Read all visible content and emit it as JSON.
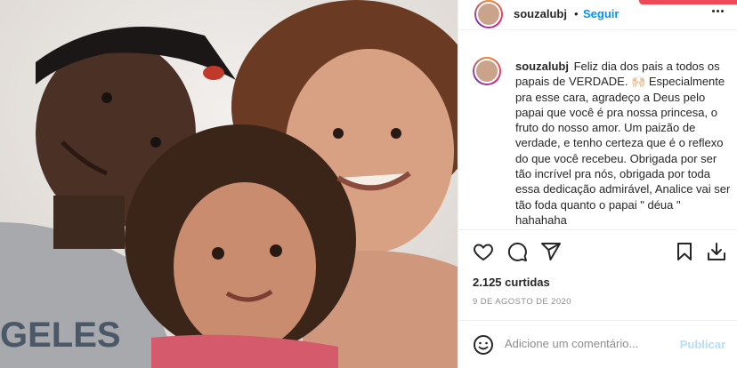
{
  "post": {
    "username": "souzalubj",
    "follow_label": "Seguir",
    "separator": "•",
    "caption": "Feliz dia dos pais a todos os papais de VERDADE. 🙌🏻 Especialmente pra esse cara, agradeço a Deus pelo papai que você é pra nossa princesa, o fruto do nosso amor. Um paizão de verdade, e tenho certeza que é o reflexo do que você recebeu. Obrigada por ser tão incrível pra nós, obrigada por toda essa dedicação admirável, Analice vai ser tão foda quanto o papai \" déua \" hahahaha",
    "likes": "2.125 curtidas",
    "date": "9 DE AGOSTO DE 2020",
    "photo_text": "GELES"
  },
  "comment_box": {
    "placeholder": "Adicione um comentário...",
    "publish_label": "Publicar"
  },
  "icons": [
    "heart-icon",
    "comment-icon",
    "share-icon",
    "bookmark-icon",
    "download-icon",
    "emoji-icon",
    "more-icon"
  ],
  "colors": {
    "accent": "#0095f6",
    "publish_disabled": "#b2dffc",
    "muted": "#8e8e8e"
  }
}
